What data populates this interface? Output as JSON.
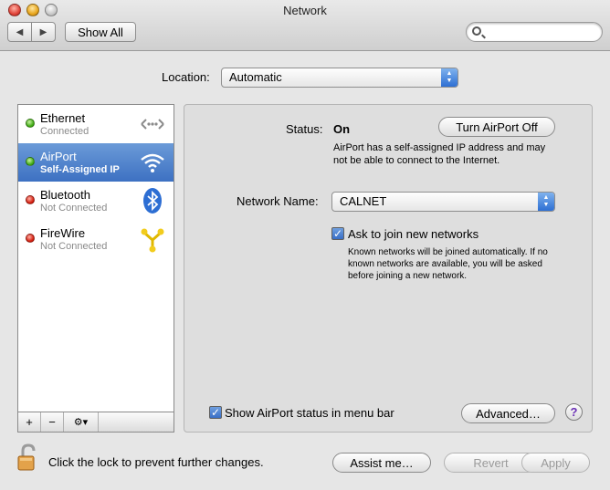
{
  "window": {
    "title": "Network"
  },
  "toolbar": {
    "back_icon": "back-arrow-icon",
    "forward_icon": "forward-arrow-icon",
    "show_all": "Show All",
    "search_placeholder": ""
  },
  "location": {
    "label": "Location:",
    "value": "Automatic"
  },
  "services": [
    {
      "name": "Ethernet",
      "status": "Connected",
      "status_color": "#3eaa12",
      "icon": "ethernet-icon"
    },
    {
      "name": "AirPort",
      "status": "Self-Assigned IP",
      "status_color": "#3eaa12",
      "icon": "wifi-icon",
      "selected": true
    },
    {
      "name": "Bluetooth",
      "status": "Not Connected",
      "status_color": "#d41b0c",
      "icon": "bluetooth-icon"
    },
    {
      "name": "FireWire",
      "status": "Not Connected",
      "status_color": "#d41b0c",
      "icon": "firewire-icon"
    }
  ],
  "sidebar_controls": {
    "add": "+",
    "remove": "−",
    "action": "⚙▾"
  },
  "main": {
    "status_label": "Status:",
    "status_value": "On",
    "turn_off_button": "Turn AirPort Off",
    "status_description": "AirPort has a self-assigned IP address and may not be able to connect to the Internet.",
    "network_name_label": "Network Name:",
    "network_name_value": "CALNET",
    "ask_join_label": "Ask to join new networks",
    "ask_join_description": "Known networks will be joined automatically. If no known networks are available, you will be asked before joining a new network.",
    "show_status_label": "Show AirPort status in menu bar",
    "advanced_button": "Advanced…",
    "help_button": "?"
  },
  "footer": {
    "lock_text": "Click the lock to prevent further changes.",
    "assist_button": "Assist me…",
    "revert_button": "Revert",
    "apply_button": "Apply"
  }
}
